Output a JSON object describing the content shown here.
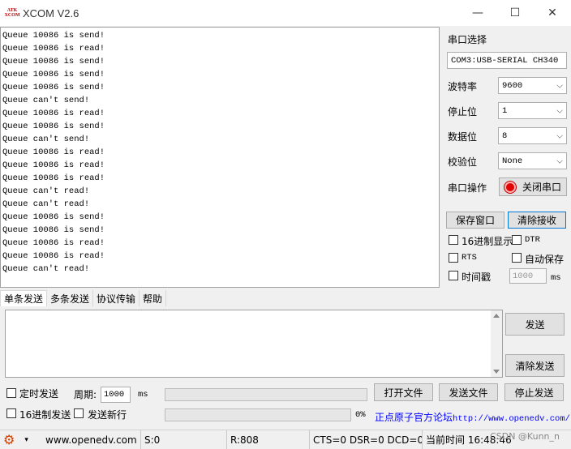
{
  "window": {
    "title": "XCOM V2.6",
    "logo_lines": [
      "ATK",
      "XCOM"
    ],
    "minimize_glyph": "—",
    "maximize_glyph": "☐",
    "close_glyph": "✕"
  },
  "receive": {
    "lines": [
      "Queue 10086 is send!",
      "Queue 10086 is read!",
      "Queue 10086 is send!",
      "Queue 10086 is send!",
      "Queue 10086 is send!",
      "Queue can't send!",
      "Queue 10086 is read!",
      "Queue 10086 is send!",
      "Queue can't send!",
      "Queue 10086 is read!",
      "Queue 10086 is read!",
      "Queue 10086 is read!",
      "Queue can't read!",
      "Queue can't read!",
      "Queue 10086 is send!",
      "Queue 10086 is send!",
      "Queue 10086 is read!",
      "Queue 10086 is read!",
      "Queue can't read!"
    ]
  },
  "panel": {
    "port_select_label": "串口选择",
    "port_value": "COM3:USB-SERIAL CH340",
    "baud_label": "波特率",
    "baud_value": "9600",
    "stopbit_label": "停止位",
    "stopbit_value": "1",
    "databit_label": "数据位",
    "databit_value": "8",
    "parity_label": "校验位",
    "parity_value": "None",
    "port_op_label": "串口操作",
    "close_port_button": "关闭串口",
    "save_window_button": "保存窗口",
    "clear_receive_button": "清除接收",
    "hex_display_label": "16进制显示",
    "dtr_label": "DTR",
    "rts_label": "RTS",
    "auto_save_label": "自动保存",
    "timestamp_label": "时间戳",
    "timestamp_value": "1000",
    "timestamp_unit": "ms"
  },
  "tabs": [
    "单条发送",
    "多条发送",
    "协议传输",
    "帮助"
  ],
  "send": {
    "send_button": "发送",
    "clear_send_button": "清除发送",
    "timed_send_label": "定时发送",
    "period_label": "周期:",
    "period_value": "1000",
    "period_unit": "ms",
    "open_file_button": "打开文件",
    "send_file_button": "发送文件",
    "stop_send_button": "停止发送",
    "hex_send_label": "16进制发送",
    "newline_label": "发送新行",
    "progress_text": "0%",
    "progress_value": 0,
    "link_text": "正点原子官方论坛",
    "link_url": "http://www.openedv.com/"
  },
  "statusbar": {
    "website": "www.openedv.com",
    "sent": "S:0",
    "received": "R:808",
    "signals": "CTS=0 DSR=0 DCD=0",
    "time_label": "当前时间 16:48:46",
    "watermark": "CSDN @Kunn_n"
  },
  "colors": {
    "record_indicator": "#e00000",
    "link": "#0000ff",
    "gear": "#d04000"
  }
}
